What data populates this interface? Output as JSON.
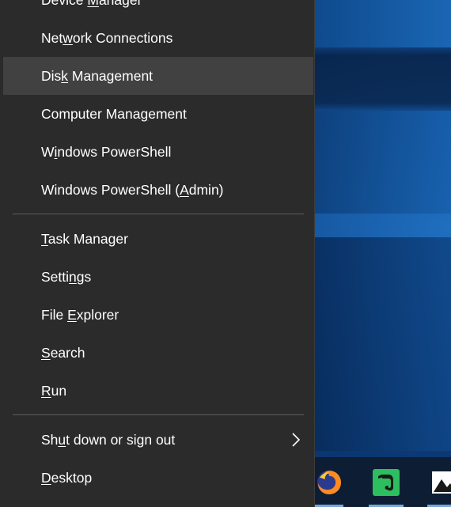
{
  "menu": {
    "items": [
      {
        "label": "Device Manager",
        "pre": "Device ",
        "key": "M",
        "post": "anager"
      },
      {
        "label": "Network Connections",
        "pre": "Net",
        "key": "w",
        "post": "ork Connections"
      },
      {
        "label": "Disk Management",
        "pre": "Dis",
        "key": "k",
        "post": " Management",
        "highlighted": true
      },
      {
        "label": "Computer Management",
        "pre": "Computer Mana",
        "key": "g",
        "post": "ement"
      },
      {
        "label": "Windows PowerShell",
        "pre": "W",
        "key": "i",
        "post": "ndows PowerShell"
      },
      {
        "label": "Windows PowerShell (Admin)",
        "pre": "Windows PowerShell (",
        "key": "A",
        "post": "dmin)"
      },
      {
        "label": "Task Manager",
        "pre": "",
        "key": "T",
        "post": "ask Manager"
      },
      {
        "label": "Settings",
        "pre": "Setti",
        "key": "n",
        "post": "gs"
      },
      {
        "label": "File Explorer",
        "pre": "File ",
        "key": "E",
        "post": "xplorer"
      },
      {
        "label": "Search",
        "pre": "",
        "key": "S",
        "post": "earch"
      },
      {
        "label": "Run",
        "pre": "",
        "key": "R",
        "post": "un"
      },
      {
        "label": "Shut down or sign out",
        "pre": "Sh",
        "key": "u",
        "post": "t down or sign out",
        "has_submenu": true
      },
      {
        "label": "Desktop",
        "pre": "",
        "key": "D",
        "post": "esktop"
      }
    ]
  },
  "taskbar": {
    "icons": [
      "firefox-icon",
      "evernote-icon",
      "photos-icon"
    ]
  },
  "colors": {
    "menu_bg": "#2b2b2b",
    "hover_bg": "#414141",
    "divider": "#5d5d5d",
    "text": "#ffffff",
    "evernote_green": "#2dbe60"
  }
}
